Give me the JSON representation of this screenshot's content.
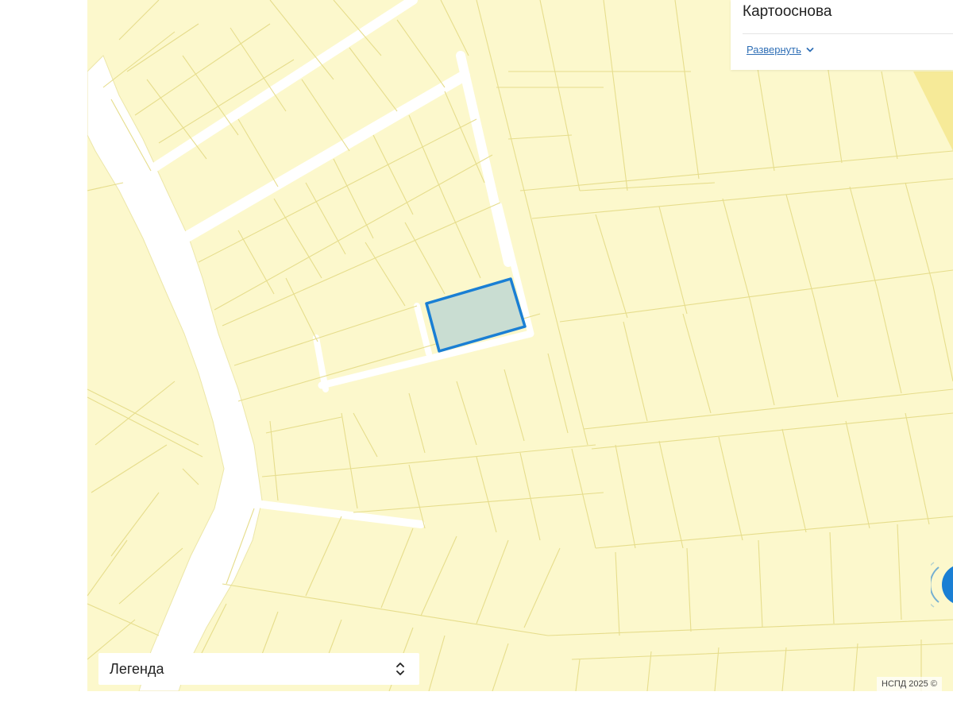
{
  "layers_panel": {
    "title": "Картооснова",
    "expand_label": "Развернуть"
  },
  "legend": {
    "label": "Легенда"
  },
  "attribution": "НСПД 2025 ©",
  "colors": {
    "map_background": "#fcf8cc",
    "parcel_border": "#e6dd8c",
    "road": "#ffffff",
    "selected_fill": "#c9ddd2",
    "selected_border": "#1a7fd4",
    "link": "#2f6fb6"
  },
  "icons": {
    "expand": "chevron-down-icon",
    "legend_toggle": "sort-arrows-icon",
    "locate": "locate-me-icon"
  },
  "map": {
    "selected_parcel": "highlighted-land-plot"
  }
}
